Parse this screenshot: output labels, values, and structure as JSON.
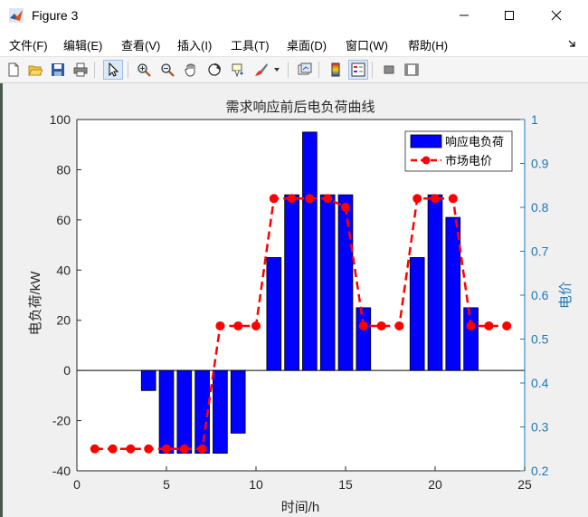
{
  "window": {
    "title": "Figure 3",
    "minimize_glyph": "─",
    "maximize_glyph": "☐",
    "close_glyph": "✕"
  },
  "menu": {
    "items": [
      {
        "label": "文件(F)",
        "key": "file"
      },
      {
        "label": "编辑(E)",
        "key": "edit"
      },
      {
        "label": "查看(V)",
        "key": "view"
      },
      {
        "label": "插入(I)",
        "key": "insert"
      },
      {
        "label": "工具(T)",
        "key": "tools"
      },
      {
        "label": "桌面(D)",
        "key": "desktop"
      },
      {
        "label": "窗口(W)",
        "key": "window"
      },
      {
        "label": "帮助(H)",
        "key": "help"
      }
    ]
  },
  "toolbar": {
    "icons": [
      "new-figure-icon",
      "open-file-icon",
      "save-icon",
      "print-icon",
      "pointer-icon",
      "zoom-in-icon",
      "zoom-out-icon",
      "pan-hand-icon",
      "rotate-3d-icon",
      "data-cursor-icon",
      "brush-icon",
      "brush-dropdown-icon",
      "link-plot-icon",
      "colorbar-icon",
      "legend-icon",
      "hide-plot-tools-icon",
      "show-plot-tools-icon"
    ]
  },
  "colors": {
    "bar_fill": "#0000ff",
    "price_line": "#ff0000",
    "right_axis": "#1f77b4",
    "figure_bg": "#f0f0f0"
  },
  "chart_data": {
    "type": "bar",
    "title": "需求响应前后电负荷曲线",
    "xlabel": "时间/h",
    "ylabel": "电负荷/kW",
    "ylabel_right": "电价",
    "xlim": [
      0,
      25
    ],
    "ylim": [
      -40,
      100
    ],
    "ylim_right": [
      0.2,
      1
    ],
    "xticks": [
      0,
      5,
      10,
      15,
      20,
      25
    ],
    "yticks": [
      -40,
      -20,
      0,
      20,
      40,
      60,
      80,
      100
    ],
    "yticks_right": [
      0.2,
      0.3,
      0.4,
      0.5,
      0.6,
      0.7,
      0.8,
      0.9,
      1
    ],
    "legend_position": "top-right",
    "series": [
      {
        "name": "响应电负荷",
        "kind": "bar",
        "x": [
          4,
          5,
          6,
          7,
          8,
          9,
          11,
          12,
          13,
          14,
          15,
          16,
          19,
          20,
          21,
          22
        ],
        "values": [
          -8,
          -33,
          -33,
          -33,
          -33,
          -25,
          45,
          70,
          95,
          70,
          70,
          25,
          45,
          70,
          61,
          25
        ]
      },
      {
        "name": "市场电价",
        "kind": "line",
        "axis": "right",
        "x": [
          1,
          2,
          3,
          4,
          5,
          6,
          7,
          8,
          9,
          10,
          11,
          12,
          13,
          14,
          15,
          16,
          17,
          18,
          19,
          20,
          21,
          22,
          23,
          24
        ],
        "values": [
          0.25,
          0.25,
          0.25,
          0.25,
          0.25,
          0.25,
          0.25,
          0.53,
          0.53,
          0.53,
          0.82,
          0.82,
          0.82,
          0.82,
          0.8,
          0.53,
          0.53,
          0.53,
          0.82,
          0.82,
          0.82,
          0.53,
          0.53,
          0.53
        ]
      }
    ]
  }
}
